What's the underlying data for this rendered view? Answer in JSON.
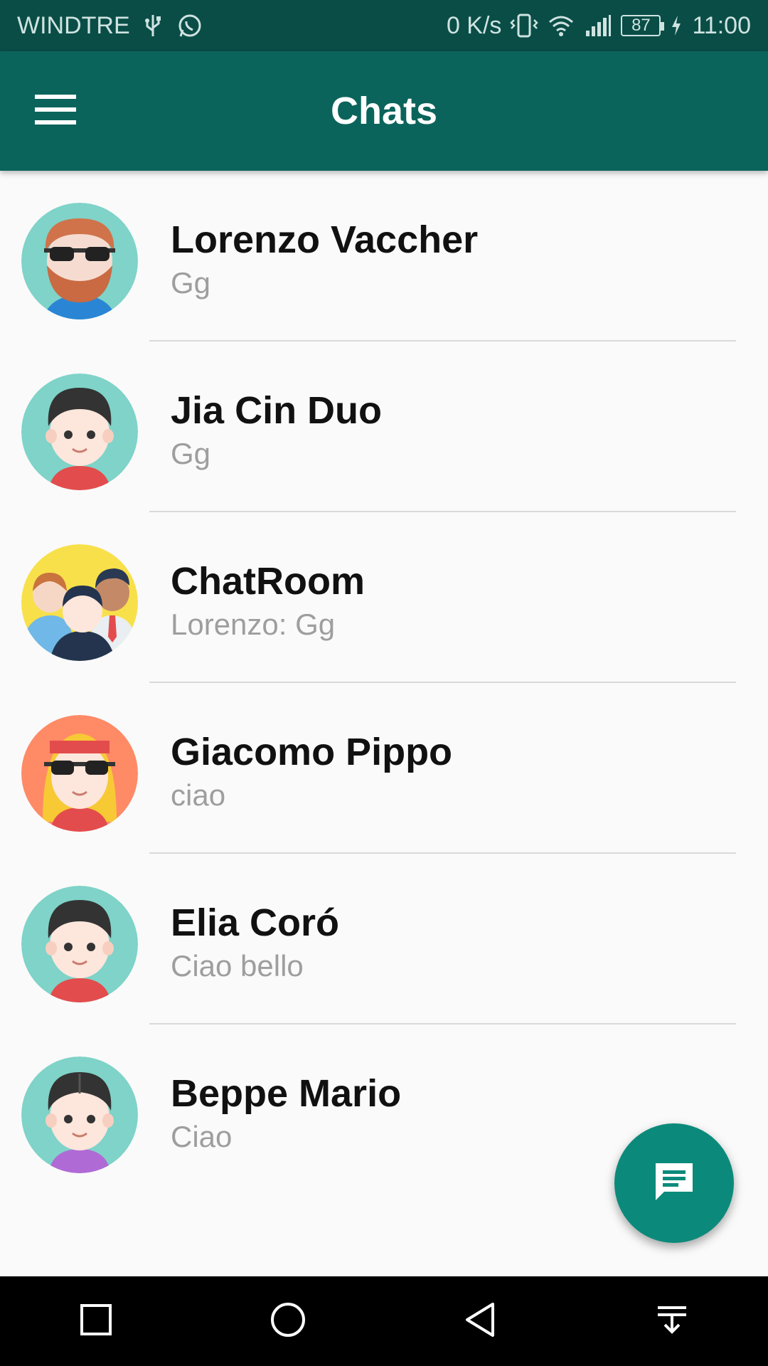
{
  "status_bar": {
    "carrier": "WINDTRE",
    "speed": "0 K/s",
    "battery": "87",
    "time": "11:00",
    "icons": [
      "usb-icon",
      "whatsapp-icon",
      "vibrate-icon",
      "wifi-icon",
      "signal-icon",
      "battery-icon",
      "charging-icon"
    ]
  },
  "app_bar": {
    "title": "Chats",
    "menu_icon": "hamburger-menu-icon",
    "color": "#0b645b"
  },
  "chats": [
    {
      "name": "Lorenzo Vaccher",
      "last_message": "Gg",
      "avatar": "bearded-man-sunglasses"
    },
    {
      "name": "Jia Cin Duo",
      "last_message": "Gg",
      "avatar": "man-dark-hair"
    },
    {
      "name": "ChatRoom",
      "last_message": "Lorenzo: Gg",
      "avatar": "group"
    },
    {
      "name": "Giacomo Pippo",
      "last_message": "ciao",
      "avatar": "woman-headband-sunglasses"
    },
    {
      "name": "Elia Coró",
      "last_message": "Ciao bello",
      "avatar": "man-dark-hair"
    },
    {
      "name": "Beppe Mario",
      "last_message": "Ciao",
      "avatar": "man-curly-hair"
    }
  ],
  "fab": {
    "icon": "chat-message-icon",
    "color": "#0b8a7b"
  },
  "nav_bar": {
    "icons": [
      "recent-apps-icon",
      "home-icon",
      "back-icon",
      "notification-pull-down-icon"
    ]
  }
}
